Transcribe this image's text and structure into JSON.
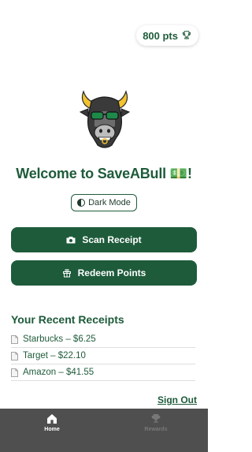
{
  "header": {
    "points": "800 pts"
  },
  "welcome": {
    "text": "Welcome to SaveABull 💵!"
  },
  "buttons": {
    "dark_mode": "Dark Mode",
    "scan_receipt": "Scan Receipt",
    "redeem_points": "Redeem Points"
  },
  "receipts": {
    "title": "Your Recent Receipts",
    "items": [
      {
        "label": "Starbucks – $6.25"
      },
      {
        "label": "Target – $22.10"
      },
      {
        "label": "Amazon – $41.55"
      }
    ]
  },
  "signout": {
    "label": "Sign Out"
  },
  "tabs": [
    {
      "label": "Home",
      "icon": "home-icon",
      "active": true
    },
    {
      "label": "Rewards",
      "icon": "trophy-icon",
      "active": false
    }
  ],
  "colors": {
    "brand_green": "#1e5b3b",
    "tabbar": "#4f4f4f",
    "accent_gold": "#f2c230"
  }
}
